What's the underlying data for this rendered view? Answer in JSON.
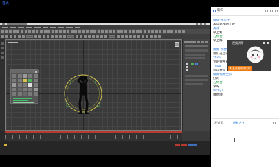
{
  "nav": {
    "home_label": "首页"
  },
  "chat": {
    "title": "聊天",
    "messages": [
      {
        "name": "薇薇-视觉庄",
        "text": "黑虎影视网上好",
        "color": "#2f7bd9"
      },
      {
        "name": "浅浅",
        "text": "早上好",
        "color": "#2f7bd9"
      },
      {
        "name": "石棉台",
        "text": "早上好",
        "color": "#2aa84a"
      },
      {
        "name": "薇薇-视觉庄",
        "text": "我们这位学员",
        "color": "#2f7bd9"
      },
      {
        "name": "Yhou",
        "text": "专的要神奇的",
        "color": "#2f7bd9"
      },
      {
        "name": "Yhou",
        "text": "可以开搞了",
        "color": "#2f7bd9"
      },
      {
        "name": "薇薇视觉空间",
        "text": "好的",
        "color": "#2f7bd9"
      },
      {
        "name": "石棉台",
        "text": "早呀",
        "color": "#2aa84a"
      },
      {
        "name": "Vicky?",
        "text": "哦哦哦",
        "color": "#2f7bd9"
      }
    ],
    "speaker_card": {
      "label": "视频讲师",
      "badge": "主讲老师讲话中"
    },
    "composer": {
      "send_to_label": "发送至",
      "recipient": "所有人"
    }
  },
  "quick_panel": {
    "button_colors": [
      "#7a7a7a",
      "#7a7a7a",
      "#9a9a9a",
      "#7a7a7a",
      "#7a7a7a",
      "#7a7a7a",
      "#7a7a7a",
      "#d8c24a",
      "#4cb35a",
      "#7a7a7a",
      "#9a9a9a",
      "#7a7a7a",
      "#7a7a7a",
      "#e0e0e0",
      "#7a7a7a",
      "#7a7a7a",
      "#6a6a6a",
      "#7a7a7a",
      "#7a7a7a",
      "#9a9a9a",
      "#7a7a7a",
      "#7a7a7a",
      "#6a6a6a",
      "#7a7a7a",
      "#7a7a7a"
    ]
  },
  "colors": {
    "link_blue": "#3d7dff",
    "name_blue": "#2f7bd9",
    "name_green": "#2aa84a",
    "badge_orange": "#f07c12",
    "timeline_red": "#b83a2e",
    "gizmo_yellow": "#cfc24e",
    "selection_green": "#3fbf6a"
  },
  "icons": {
    "chat_header": "chat-bubble-icon",
    "badge": "microphone-icon",
    "composer": "emoji-icon",
    "recipient": "chevron-down-icon"
  }
}
